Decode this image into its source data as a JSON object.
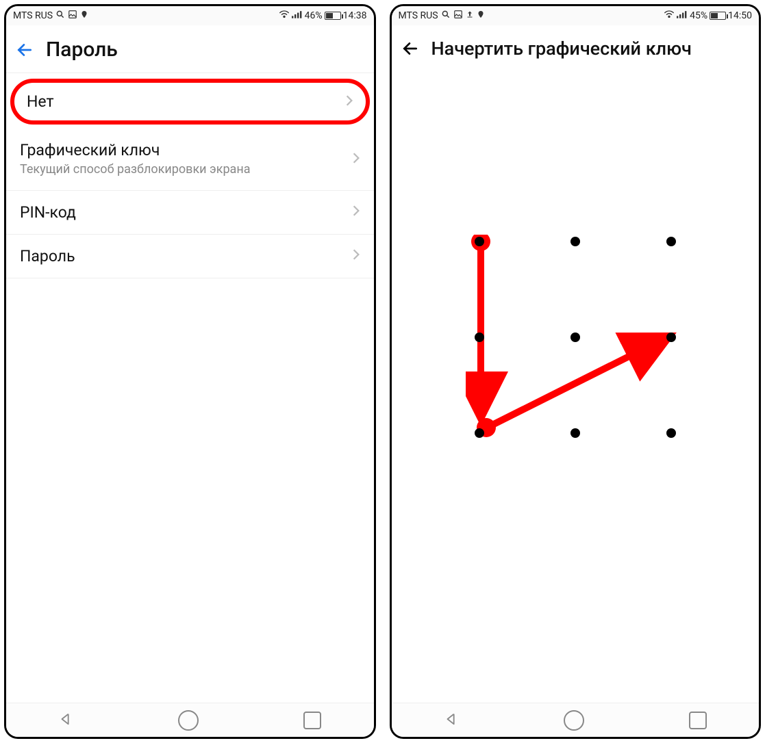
{
  "left": {
    "status": {
      "carrier": "MTS RUS",
      "battery_pct": "46%",
      "time": "14:38"
    },
    "header": {
      "title": "Пароль"
    },
    "items": [
      {
        "title": "Нет",
        "sub": "",
        "highlighted": true
      },
      {
        "title": "Графический ключ",
        "sub": "Текущий способ разблокировки экрана",
        "highlighted": false
      },
      {
        "title": "PIN-код",
        "sub": "",
        "highlighted": false
      },
      {
        "title": "Пароль",
        "sub": "",
        "highlighted": false
      }
    ]
  },
  "right": {
    "status": {
      "carrier": "MTS RUS",
      "battery_pct": "45%",
      "time": "14:50"
    },
    "header": {
      "title": "Начертить графический ключ"
    },
    "pattern": {
      "dots": [
        [
          0,
          0
        ],
        [
          1,
          0
        ],
        [
          2,
          0
        ],
        [
          0,
          1
        ],
        [
          1,
          1
        ],
        [
          2,
          1
        ],
        [
          0,
          2
        ],
        [
          1,
          2
        ],
        [
          2,
          2
        ]
      ],
      "path_sequence": [
        [
          0,
          0
        ],
        [
          0,
          2
        ],
        [
          2,
          1
        ]
      ],
      "highlight_dots": [
        [
          0,
          0
        ],
        [
          0,
          2
        ]
      ]
    }
  },
  "annotation_color": "#ff0000"
}
